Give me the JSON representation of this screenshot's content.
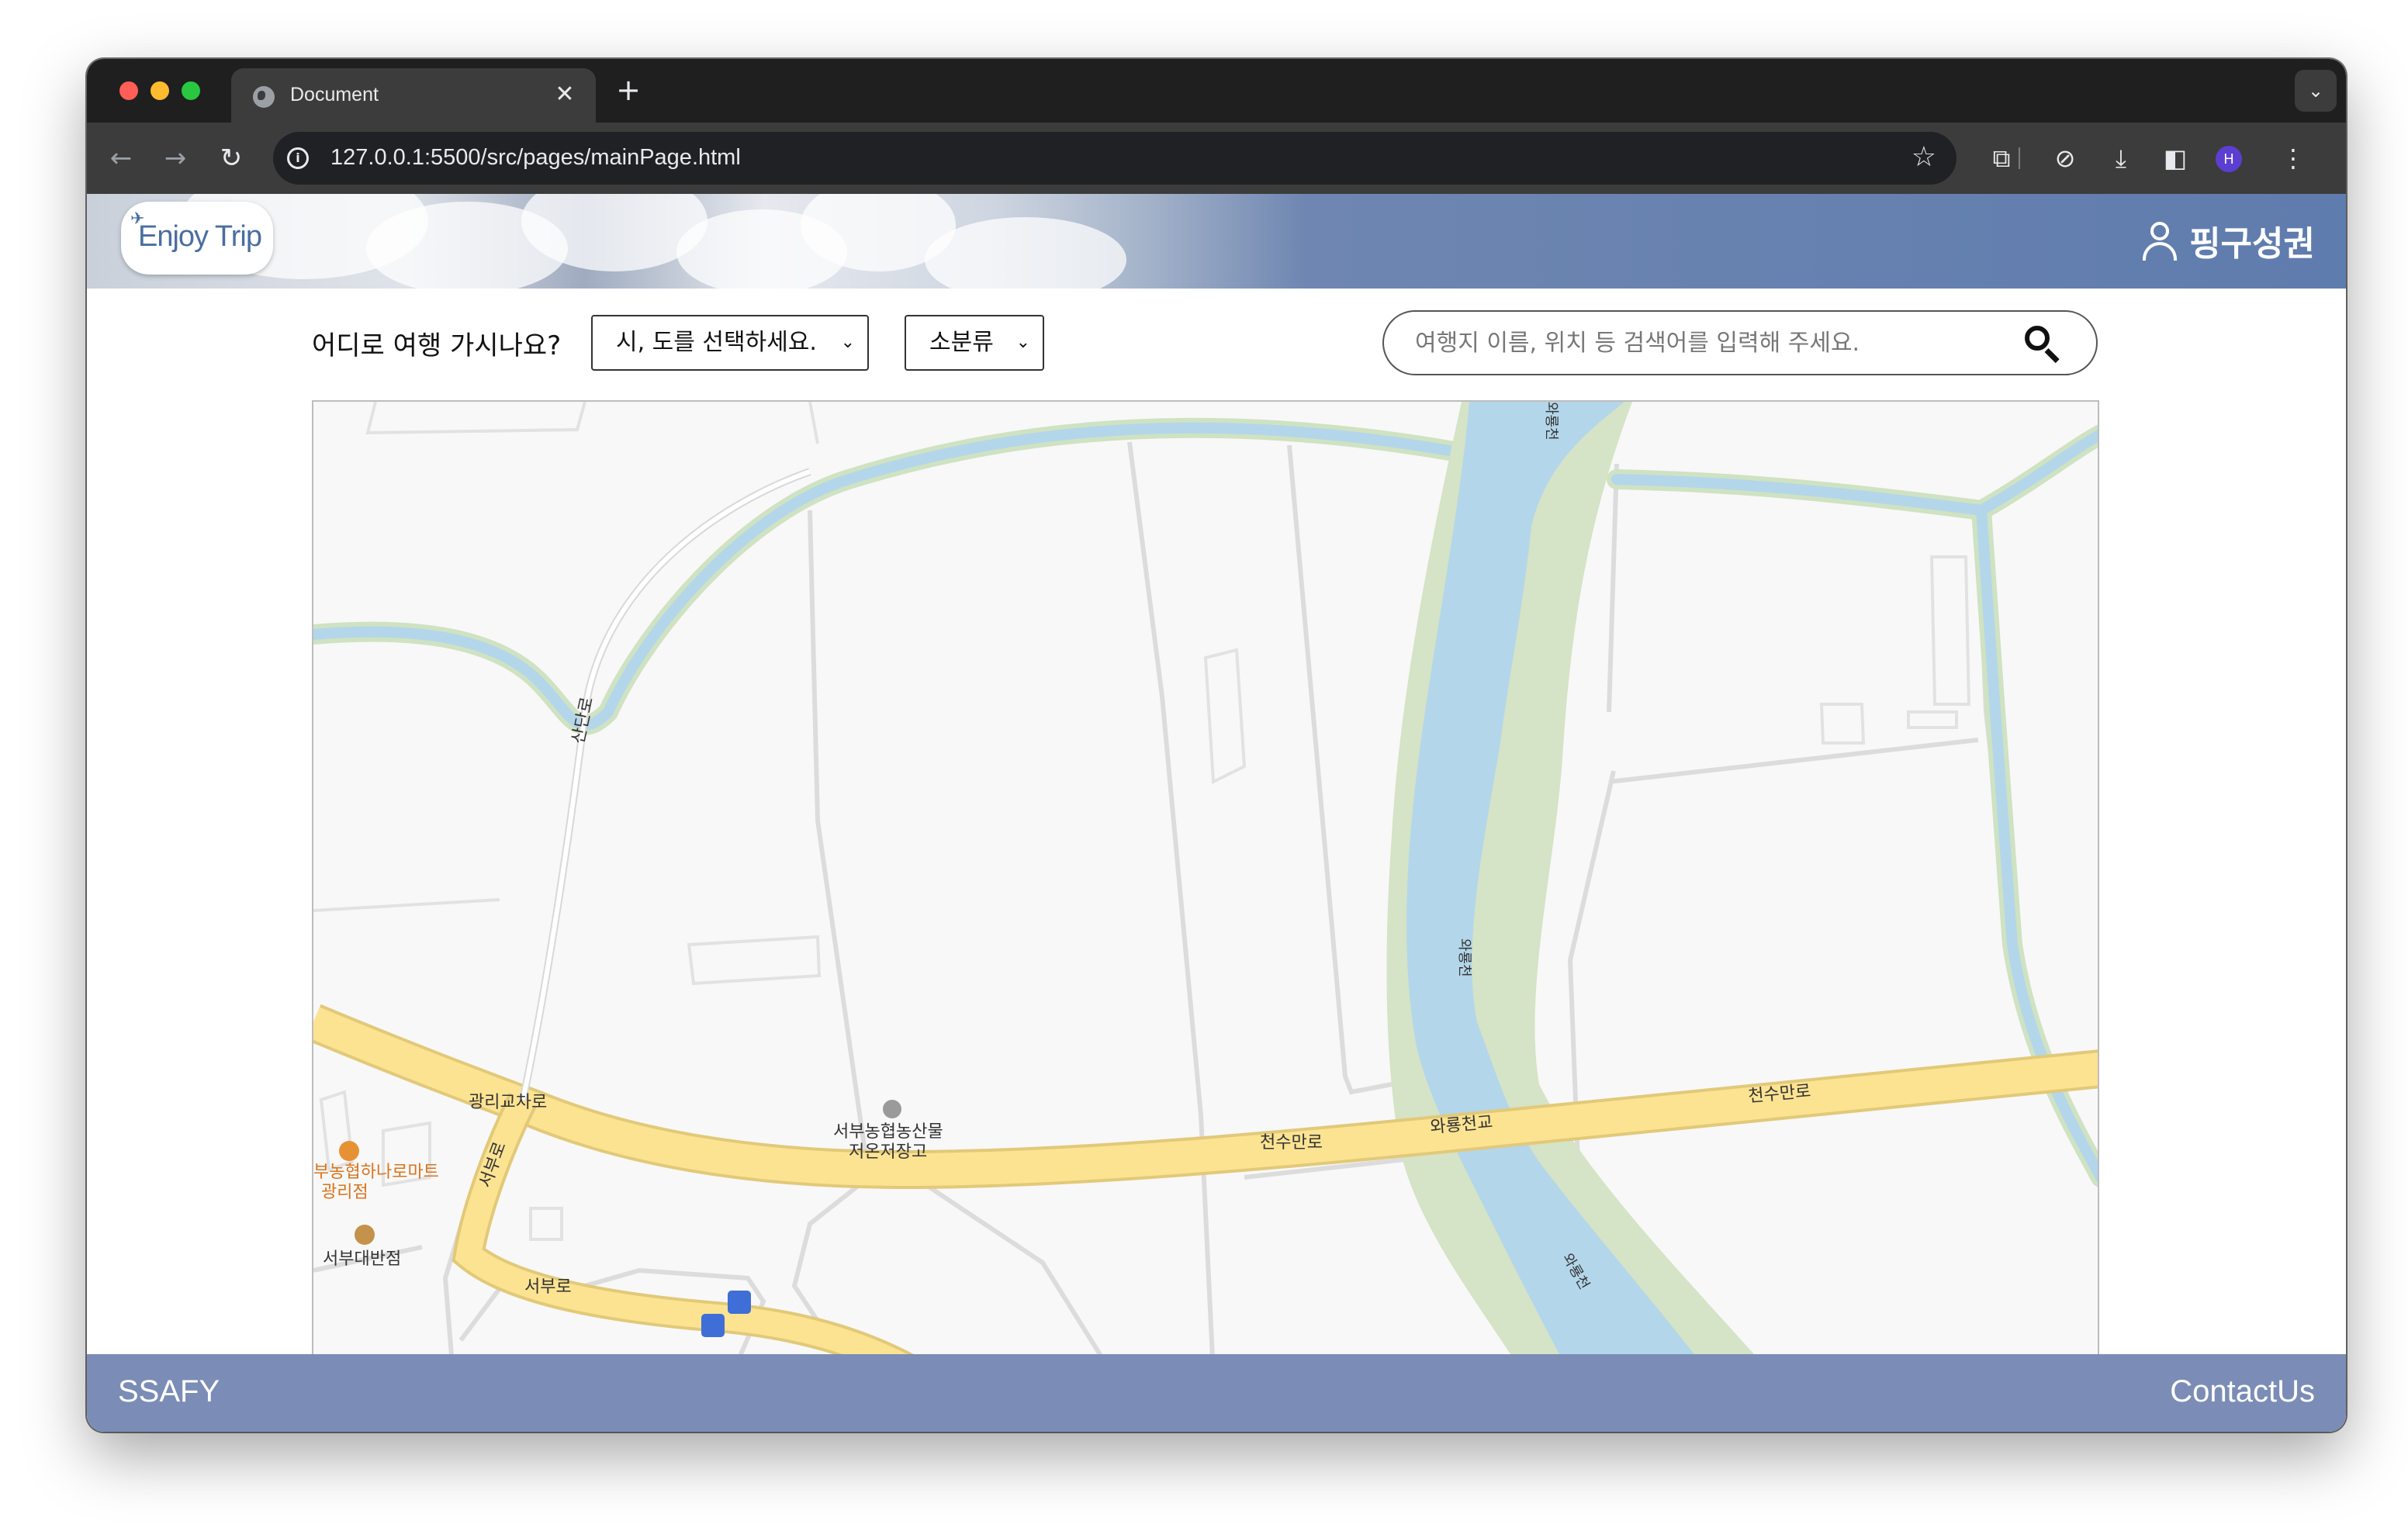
{
  "browser": {
    "tab_title": "Document",
    "url": "127.0.0.1:5500/src/pages/mainPage.html",
    "close_tab": "✕",
    "new_tab": "+",
    "profile_initial": "H"
  },
  "header": {
    "logo_text": "Enjoy Trip",
    "user_name": "핑구성권"
  },
  "search": {
    "question": "어디로 여행 가시나요?",
    "sido_selected": "시, 도를 선택하세요.",
    "category_selected": "소분류",
    "placeholder": "여행지 이름, 위치 등 검색어를 입력해 주세요."
  },
  "map": {
    "labels": {
      "road_sadanro": "산단로",
      "intersection": "광리교차로",
      "road_seobu_vertical": "서부로",
      "road_seobu": "서부로",
      "warehouse_line1": "서부농협농산물",
      "warehouse_line2": "저온저장고",
      "mart_line1": "부농협하나로마트",
      "mart_line2": "광리점",
      "restaurant": "서부대반점",
      "road_cheonsu_1": "천수만로",
      "road_cheonsu_2": "천수만로",
      "bridge": "와룡천교",
      "stream_1": "와룡천",
      "stream_2": "와룡천",
      "stream_3": "와룡천"
    }
  },
  "footer": {
    "left": "SSAFY",
    "right": "ContactUs"
  },
  "colors": {
    "header_blue": "#5f7cae",
    "footer": "#7b8db6",
    "map_water": "#b3d6ea",
    "map_road_major": "#fbe392",
    "map_green": "#d5e3c6"
  }
}
